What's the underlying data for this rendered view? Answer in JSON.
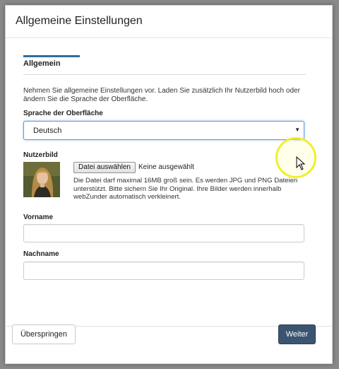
{
  "dialog": {
    "title": "Allgemeine Einstellungen"
  },
  "tabs": [
    {
      "label": "Allgemein",
      "active": true
    }
  ],
  "intro_text": "Nehmen Sie allgemeine Einstellungen vor. Laden Sie zusätzlich Ihr Nutzerbild hoch oder ändern Sie die Sprache der Oberfläche.",
  "language": {
    "label": "Sprache der Oberfläche",
    "selected": "Deutsch"
  },
  "profile_picture": {
    "label": "Nutzerbild",
    "file_button_label": "Datei auswählen",
    "file_status": "Keine ausgewählt",
    "help_text": "Die Datei darf maximal 16MB groß sein. Es werden JPG und PNG Dateien unterstützt. Bitte sichern Sie Ihr Original. Ihre Bilder werden innerhalb webZunder automatisch verkleinert."
  },
  "first_name": {
    "label": "Vorname",
    "value": ""
  },
  "last_name": {
    "label": "Nachname",
    "value": ""
  },
  "footer": {
    "skip_label": "Überspringen",
    "next_label": "Weiter"
  },
  "icons": {
    "select_caret": "caret-down-icon",
    "cursor": "mouse-pointer-icon"
  },
  "colors": {
    "tab_accent": "#2e6da4",
    "primary_button": "#3b5571",
    "cursor_highlight": "#f1ee2d",
    "focus_border": "#5b9dd9"
  }
}
